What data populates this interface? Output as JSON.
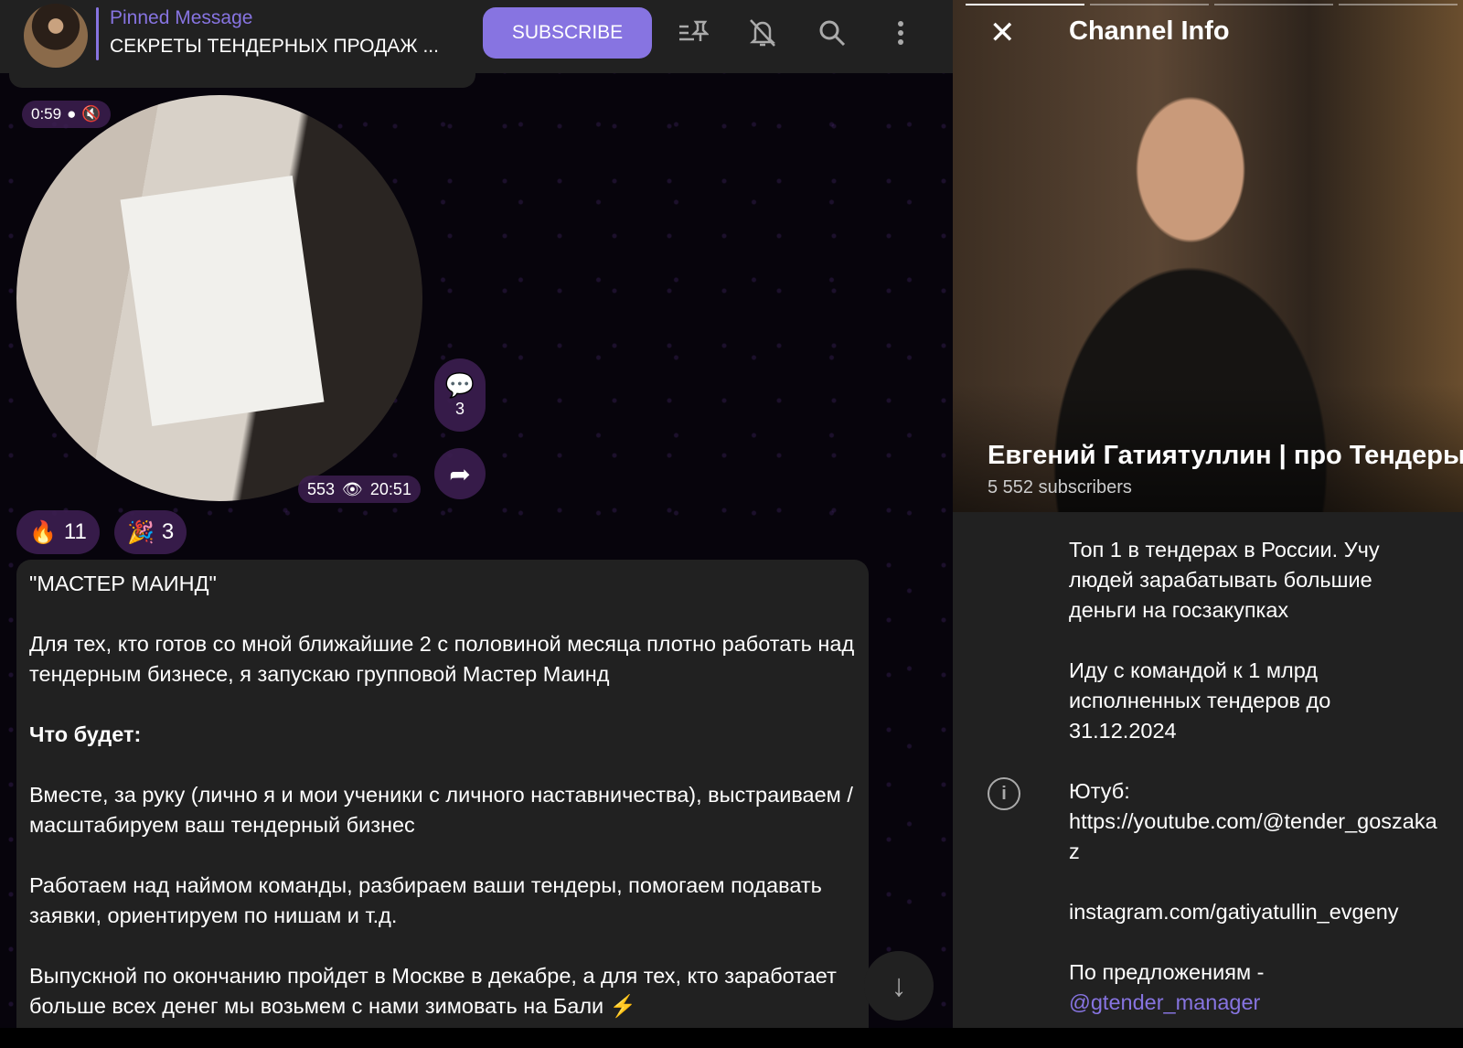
{
  "header": {
    "pinned_title": "Pinned Message",
    "pinned_text": "СЕКРЕТЫ ТЕНДЕРНЫХ ПРОДАЖ ...",
    "subscribe": "SUBSCRIBE"
  },
  "video": {
    "duration": "0:59",
    "views": "553",
    "time": "20:51",
    "comments": "3"
  },
  "reactions": [
    {
      "emoji": "🔥",
      "count": "11"
    },
    {
      "emoji": "🎉",
      "count": "3"
    }
  ],
  "message": {
    "title": "\"МАСТЕР МАИНД\"",
    "p1": "Для тех, кто готов со мной ближайшие 2 с половиной месяца плотно работать над тендерным бизнесе, я запускаю групповой Мастер Маинд",
    "p2": "Что будет:",
    "p3": "Вместе, за руку (лично я и мои ученики с личного наставничества), выстраиваем / масштабируем ваш тендерный бизнес",
    "p4": "Работаем над наймом команды, разбираем ваши тендеры, помогаем подавать заявки, ориентируем по нишам и т.д.",
    "p5": "Выпускной по окончанию пройдет в Москве в декабре, а для тех, кто заработает больше всех денег мы возьмем с нами зимовать на Бали ⚡"
  },
  "channel_info": {
    "title": "Channel Info",
    "name": "Евгений Гатиятуллин | про Тендеры",
    "subscribers": "5 552 subscribers",
    "desc1": "Топ 1 в тендерах в России. Учу людей зарабатывать большие деньги на госзакупках",
    "desc2": "Иду с командой к 1 млрд исполненных тендеров до 31.12.2024",
    "youtube_label": "Ютуб:",
    "youtube": "https://youtube.com/@tender_goszakaz",
    "instagram": "instagram.com/gatiyatullin_evgeny",
    "offers": "По предложениям -",
    "manager": "@gtender_manager"
  }
}
